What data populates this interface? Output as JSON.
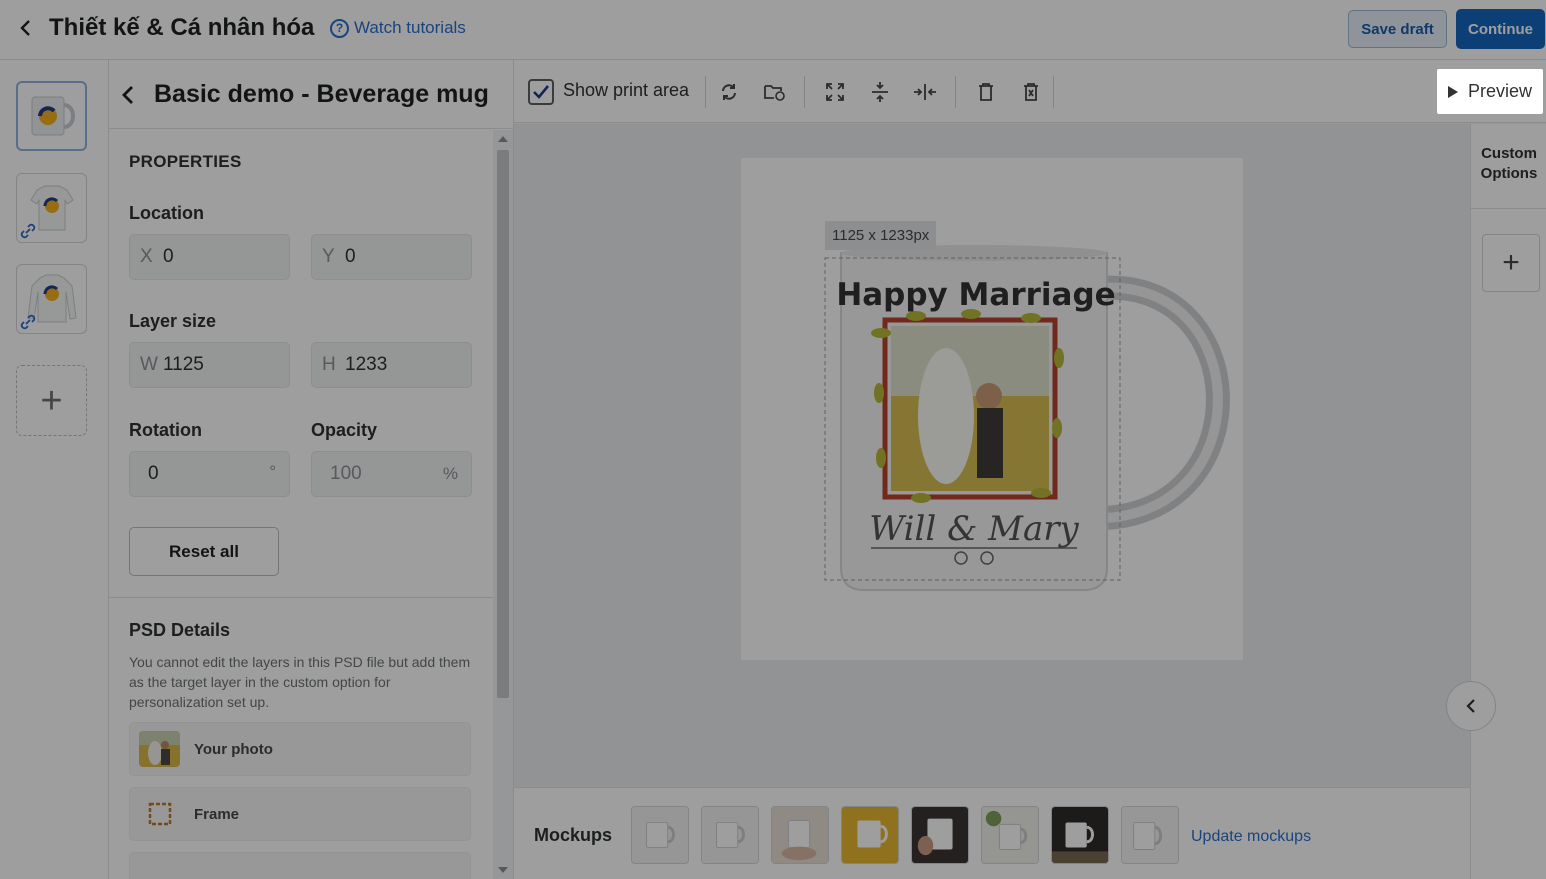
{
  "header": {
    "title": "Thiết kế & Cá nhân hóa",
    "tutorials": "Watch tutorials",
    "save_draft": "Save draft",
    "continue": "Continue"
  },
  "panel": {
    "title": "Basic demo - Beverage mug",
    "properties": "PROPERTIES",
    "location_label": "Location",
    "x_prefix": "X",
    "x_value": "0",
    "y_prefix": "Y",
    "y_value": "0",
    "layer_size_label": "Layer size",
    "w_prefix": "W",
    "w_value": "1125",
    "h_prefix": "H",
    "h_value": "1233",
    "rotation_label": "Rotation",
    "rotation_value": "0",
    "rotation_unit": "°",
    "opacity_label": "Opacity",
    "opacity_value": "100",
    "opacity_unit": "%",
    "reset_all": "Reset all",
    "psd_title": "PSD Details",
    "psd_desc": "You cannot edit the layers in this PSD file but add them as the target layer in the custom option for personalization set up.",
    "layers": [
      {
        "name": "Your photo"
      },
      {
        "name": "Frame"
      }
    ]
  },
  "toolbar": {
    "show_print_area": "Show print area",
    "show_print_area_checked": true,
    "preview": "Preview"
  },
  "canvas": {
    "dimensions": "1125 x 1233px",
    "mug_text_top": "Happy Marriage",
    "mug_text_bottom": "Will & Mary"
  },
  "right": {
    "custom_options": "Custom Options"
  },
  "mockups": {
    "label": "Mockups",
    "update": "Update mockups"
  }
}
